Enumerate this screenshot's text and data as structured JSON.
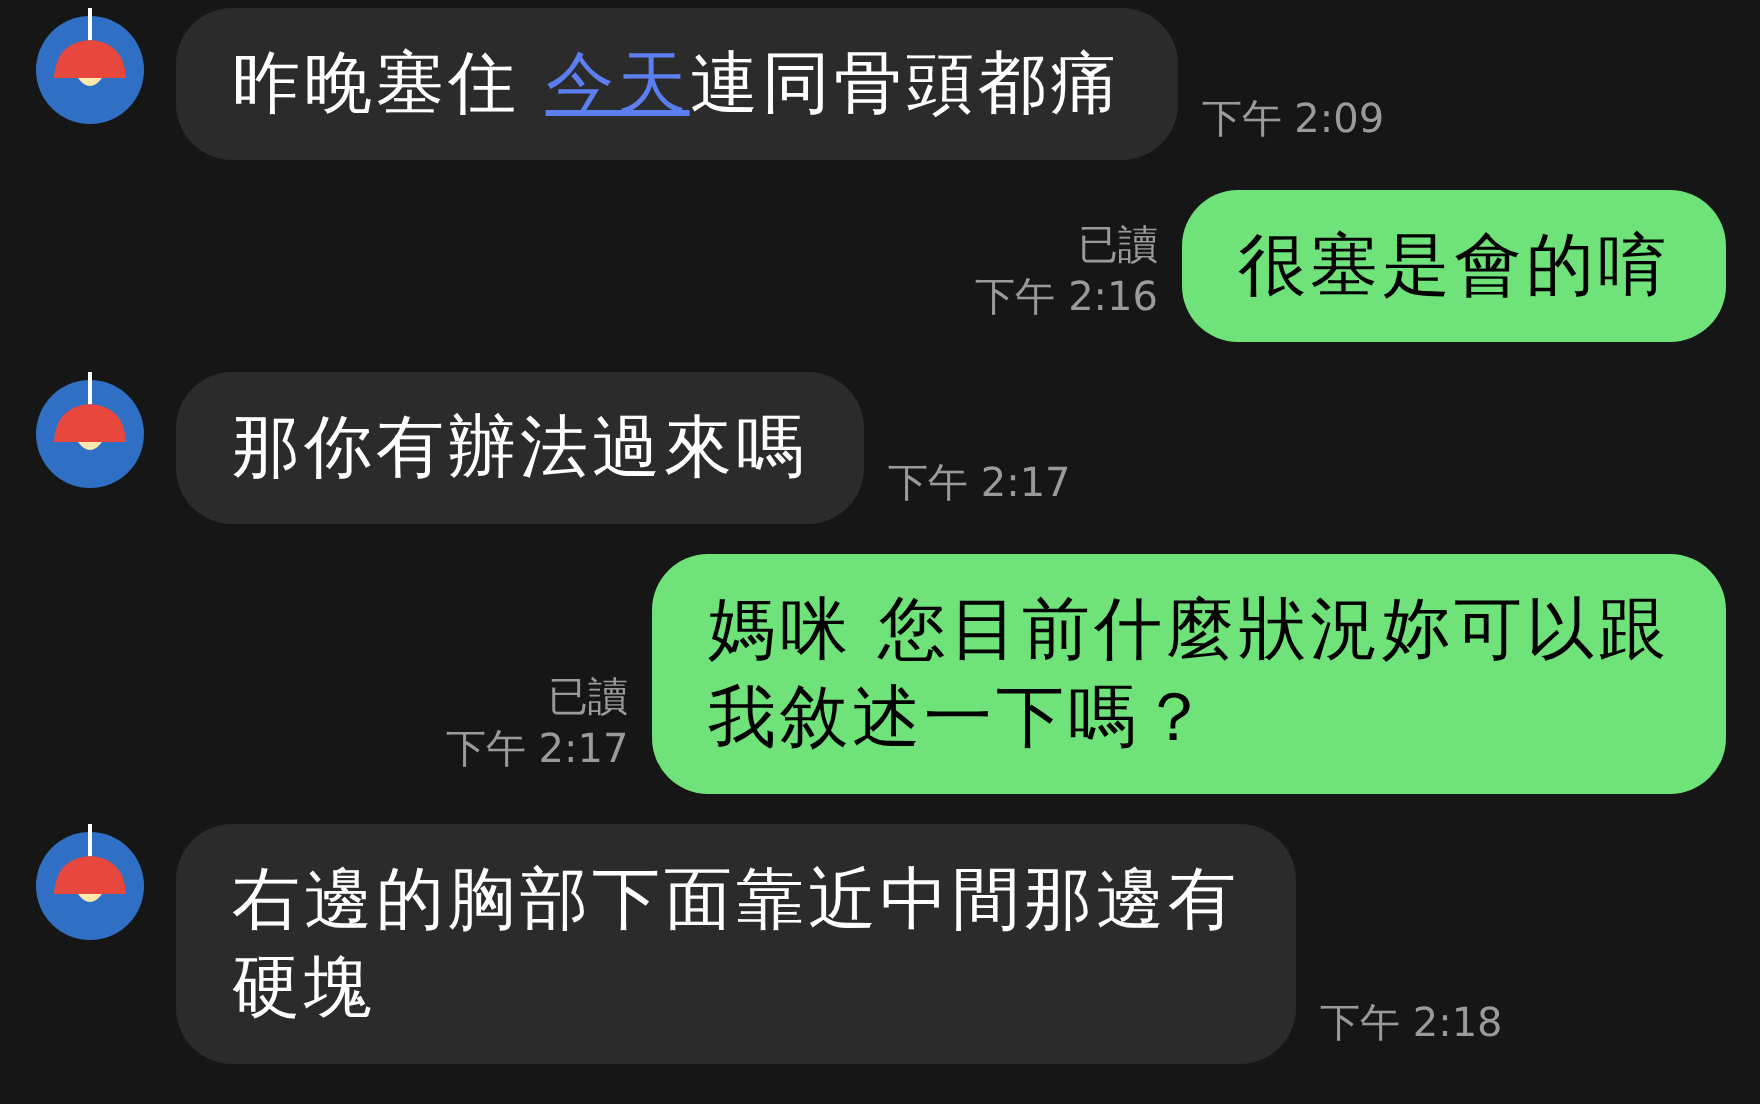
{
  "messages": [
    {
      "kind": "incoming",
      "segments": [
        {
          "kind": "text",
          "text": "昨晚塞住 "
        },
        {
          "kind": "link",
          "text": "今天"
        },
        {
          "kind": "text",
          "text": "連同骨頭都痛"
        }
      ],
      "time": "下午 2:09"
    },
    {
      "kind": "outgoing",
      "segments": [
        {
          "kind": "text",
          "text": "很塞是會的唷"
        }
      ],
      "read": "已讀",
      "time": "下午 2:16"
    },
    {
      "kind": "incoming",
      "segments": [
        {
          "kind": "text",
          "text": "那你有辦法過來嗎"
        }
      ],
      "time": "下午 2:17"
    },
    {
      "kind": "outgoing",
      "segments": [
        {
          "kind": "text",
          "text": "媽咪 您目前什麼狀況妳可以跟"
        },
        {
          "kind": "break"
        },
        {
          "kind": "text",
          "text": "我敘述一下嗎？"
        }
      ],
      "read": "已讀",
      "time": "下午 2:17"
    },
    {
      "kind": "incoming",
      "segments": [
        {
          "kind": "text",
          "text": "右邊的胸部下面靠近中間那邊有"
        },
        {
          "kind": "break"
        },
        {
          "kind": "text",
          "text": "硬塊"
        }
      ],
      "time": "下午 2:18"
    }
  ]
}
